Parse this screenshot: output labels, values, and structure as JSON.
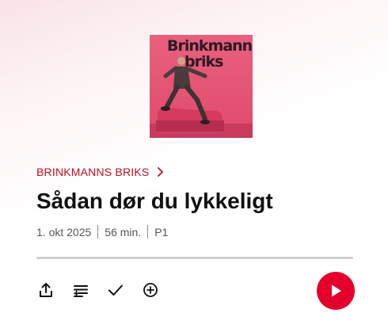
{
  "cover": {
    "title_line1": "Brinkmanns",
    "title_line2": "briks",
    "background_color": "#e04a6c"
  },
  "show": {
    "name": "BRINKMANNS BRIKS",
    "chevron_icon": "chevron-right-icon",
    "color": "#c20e1f"
  },
  "episode": {
    "title": "Sådan dør du lykkeligt",
    "date": "1. okt 2025",
    "duration": "56 min.",
    "channel": "P1",
    "progress_fraction": 0
  },
  "actions": [
    {
      "name": "share-button",
      "icon": "share-icon"
    },
    {
      "name": "add-to-queue-button",
      "icon": "playlist-add-icon"
    },
    {
      "name": "mark-as-played-button",
      "icon": "checkmark-icon"
    },
    {
      "name": "add-button",
      "icon": "plus-circle-icon"
    }
  ],
  "play": {
    "icon": "play-icon",
    "color": "#e4002b"
  }
}
